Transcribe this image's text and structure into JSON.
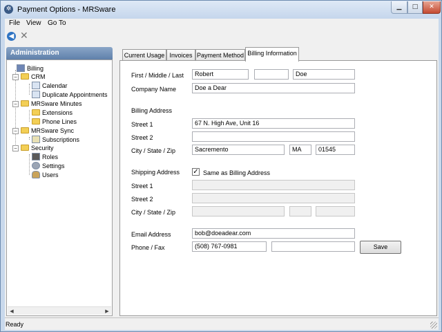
{
  "window": {
    "title": "Payment Options - MRSware",
    "minimize": "▁",
    "maximize": "□",
    "close": "✕"
  },
  "menu": {
    "items": [
      "File",
      "View",
      "Go To"
    ]
  },
  "toolbar": {
    "back_glyph": "◀",
    "cancel_glyph": "✕"
  },
  "sidebar": {
    "header": "Administration",
    "items": [
      "Billing",
      "CRM",
      "Calendar",
      "Duplicate Appointments",
      "MRSware Minutes",
      "Extensions",
      "Phone Lines",
      "MRSware Sync",
      "Subscriptions",
      "Security",
      "Roles",
      "Settings",
      "Users"
    ],
    "scroll_left": "◀",
    "scroll_right": "▶"
  },
  "tabs": [
    "Current Usage",
    "Invoices",
    "Payment Method",
    "Billing Information"
  ],
  "active_tab": "Billing Information",
  "form": {
    "name_label": "First / Middle / Last",
    "first": "Robert",
    "middle": "",
    "last": "Doe",
    "company_label": "Company Name",
    "company": "Doe a Dear",
    "billing_heading": "Billing Address",
    "street1_label": "Street 1",
    "street1": "67 N. High Ave, Unit 16",
    "street2_label": "Street 2",
    "street2": "",
    "csz_label": "City / State / Zip",
    "city": "Sacremento",
    "state": "MA",
    "zip": "01545",
    "shipping_heading": "Shipping Address",
    "same_as_billing_label": "Same as Billing Address",
    "same_as_billing_mark": "✓",
    "ship_street1_label": "Street 1",
    "ship_street2_label": "Street 2",
    "ship_csz_label": "City / State / Zip",
    "email_label": "Email Address",
    "email": "bob@doeadear.com",
    "phone_label": "Phone / Fax",
    "phone": "(508) 767-0981",
    "fax": "",
    "save_label": "Save"
  },
  "status": {
    "text": "Ready"
  }
}
